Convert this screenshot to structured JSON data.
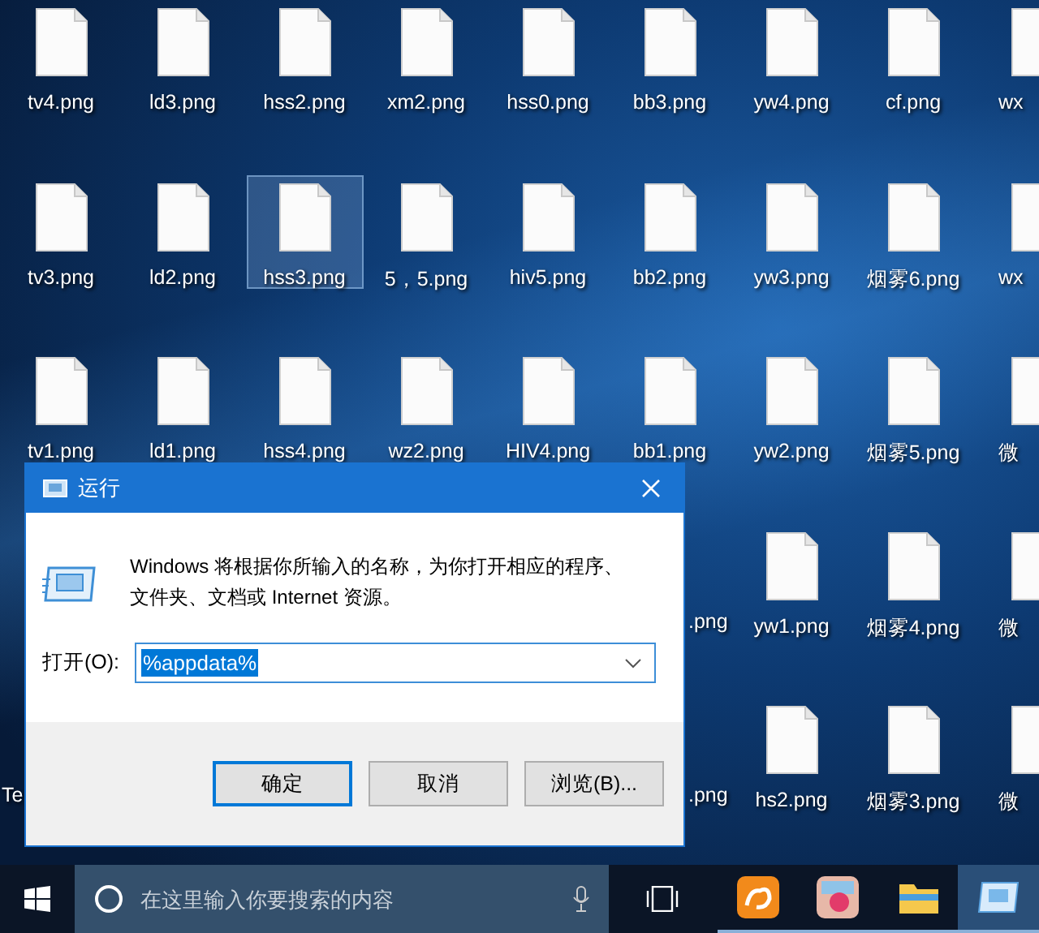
{
  "desktop": {
    "rows": [
      [
        {
          "kind": "file",
          "label": "tv4.png",
          "selected": false
        },
        {
          "kind": "file",
          "label": "ld3.png",
          "selected": false
        },
        {
          "kind": "file",
          "label": "hss2.png",
          "selected": false
        },
        {
          "kind": "file",
          "label": "xm2.png",
          "selected": false
        },
        {
          "kind": "file",
          "label": "hss0.png",
          "selected": false
        },
        {
          "kind": "file",
          "label": "bb3.png",
          "selected": false
        },
        {
          "kind": "file",
          "label": "yw4.png",
          "selected": false
        },
        {
          "kind": "file",
          "label": "cf.png",
          "selected": false
        },
        {
          "kind": "cut-right",
          "label": "wx",
          "selected": false
        }
      ],
      [
        {
          "kind": "file",
          "label": "tv3.png",
          "selected": false
        },
        {
          "kind": "file",
          "label": "ld2.png",
          "selected": false
        },
        {
          "kind": "file",
          "label": "hss3.png",
          "selected": true
        },
        {
          "kind": "file",
          "label": "5，5.png",
          "selected": false
        },
        {
          "kind": "file",
          "label": "hiv5.png",
          "selected": false
        },
        {
          "kind": "file",
          "label": "bb2.png",
          "selected": false
        },
        {
          "kind": "file",
          "label": "yw3.png",
          "selected": false
        },
        {
          "kind": "file",
          "label": "烟雾6.png",
          "selected": false
        },
        {
          "kind": "cut-right",
          "label": "wx",
          "selected": false
        }
      ],
      [
        {
          "kind": "file",
          "label": "tv1.png",
          "selected": false
        },
        {
          "kind": "file",
          "label": "ld1.png",
          "selected": false
        },
        {
          "kind": "file",
          "label": "hss4.png",
          "selected": false
        },
        {
          "kind": "file",
          "label": "wz2.png",
          "selected": false
        },
        {
          "kind": "file",
          "label": "HIV4.png",
          "selected": false
        },
        {
          "kind": "file",
          "label": "bb1.png",
          "selected": false
        },
        {
          "kind": "file",
          "label": "yw2.png",
          "selected": false
        },
        {
          "kind": "file",
          "label": "烟雾5.png",
          "selected": false
        },
        {
          "kind": "cut-right",
          "label": "微",
          "selected": false
        }
      ],
      [
        null,
        null,
        null,
        null,
        null,
        {
          "kind": "tail",
          "label": ".png",
          "selected": false
        },
        {
          "kind": "file",
          "label": "yw1.png",
          "selected": false
        },
        {
          "kind": "file",
          "label": "烟雾4.png",
          "selected": false
        },
        {
          "kind": "cut-right",
          "label": "微",
          "selected": false
        }
      ],
      [
        {
          "kind": "cut-left",
          "label": "Te",
          "selected": false
        },
        null,
        null,
        null,
        null,
        {
          "kind": "tail",
          "label": ".png",
          "selected": false
        },
        {
          "kind": "file",
          "label": "hs2.png",
          "selected": false
        },
        {
          "kind": "file",
          "label": "烟雾3.png",
          "selected": false
        },
        {
          "kind": "cut-right",
          "label": "微",
          "selected": false
        }
      ]
    ]
  },
  "run_dialog": {
    "title": "运行",
    "description": "Windows 将根据你所输入的名称，为你打开相应的程序、文件夹、文档或 Internet 资源。",
    "open_label": "打开(O):",
    "open_value": "%appdata%",
    "buttons": [
      {
        "label": "确定",
        "default": true
      },
      {
        "label": "取消",
        "default": false
      },
      {
        "label": "浏览(B)...",
        "default": false
      }
    ]
  },
  "taskbar": {
    "search_placeholder": "在这里输入你要搜索的内容",
    "apps": [
      {
        "kind": "browser",
        "active": false
      },
      {
        "kind": "media",
        "active": false
      },
      {
        "kind": "explorer",
        "active": false
      },
      {
        "kind": "run",
        "active": true
      }
    ]
  }
}
